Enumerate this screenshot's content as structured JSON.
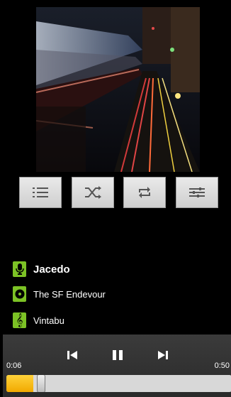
{
  "controls": [
    {
      "name": "playlist-button",
      "icon": "list-icon"
    },
    {
      "name": "shuffle-button",
      "icon": "shuffle-icon"
    },
    {
      "name": "repeat-button",
      "icon": "repeat-icon"
    },
    {
      "name": "equalizer-button",
      "icon": "equalizer-icon"
    }
  ],
  "track": {
    "artist": "Jacedo",
    "album": "The SF Endevour",
    "title": "Vintabu"
  },
  "player": {
    "elapsed": "0:06",
    "duration": "0:50",
    "progress_fraction": 0.12
  },
  "colors": {
    "accent_green": "#7cc225",
    "progress_yellow": "#f5b400",
    "control_gray": "#dcdcdc"
  }
}
